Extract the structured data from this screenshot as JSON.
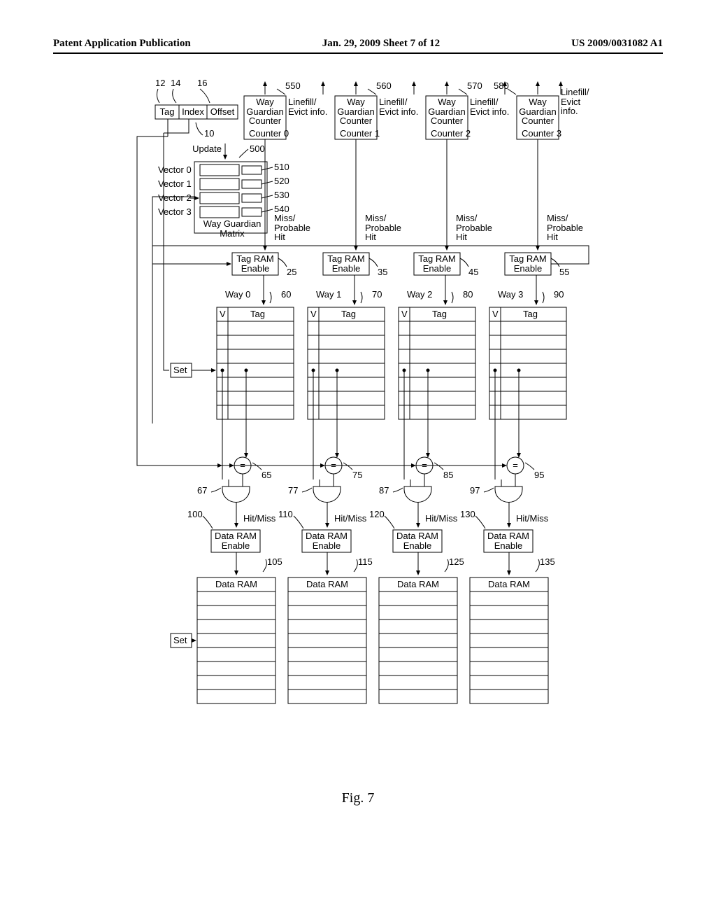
{
  "header": {
    "left": "Patent Application Publication",
    "middle": "Jan. 29, 2009  Sheet 7 of 12",
    "right": "US 2009/0031082 A1"
  },
  "figure": "Fig. 7",
  "address": {
    "n12": "12",
    "n14": "14",
    "n16": "16",
    "tag": "Tag",
    "index": "Index",
    "offset": "Offset",
    "n10": "10"
  },
  "update": "Update",
  "matrix": {
    "n500": "500",
    "n510": "510",
    "n520": "520",
    "n530": "530",
    "n540": "540",
    "v0": "Vector 0",
    "v1": "Vector 1",
    "v2": "Vector 2",
    "v3": "Vector 3",
    "title": "Way Guardian\nMatrix"
  },
  "wayGuardian": {
    "label": "Way\nGuardian\nCounter",
    "n550": "550",
    "n560": "560",
    "n570": "570",
    "n580": "580",
    "c0": "Counter 0",
    "c1": "Counter 1",
    "c2": "Counter 2",
    "c3": "Counter 3",
    "lf": "Linefill/\nEvict info.",
    "lfR": "Linefill/\nEvict\ninfo."
  },
  "miss": "Miss/\nProbable\nHit",
  "tre": {
    "label": "Tag RAM\nEnable",
    "n25": "25",
    "n35": "35",
    "n45": "45",
    "n55": "55"
  },
  "ways": {
    "label": "Way",
    "w0": "Way 0",
    "w1": "Way 1",
    "w2": "Way 2",
    "w3": "Way 3",
    "n60": "60",
    "n70": "70",
    "n80": "80",
    "n90": "90",
    "v": "V",
    "tag": "Tag"
  },
  "set": "Set",
  "cmp": {
    "n65": "65",
    "n75": "75",
    "n85": "85",
    "n95": "95"
  },
  "and": {
    "n67": "67",
    "n77": "77",
    "n87": "87",
    "n97": "97"
  },
  "hm": "Hit/Miss",
  "dre": {
    "label": "Data RAM\nEnable",
    "n100": "100",
    "n110": "110",
    "n120": "120",
    "n130": "130"
  },
  "dr": {
    "label": "Data RAM",
    "n105": "105",
    "n115": "115",
    "n125": "125",
    "n135": "135"
  }
}
